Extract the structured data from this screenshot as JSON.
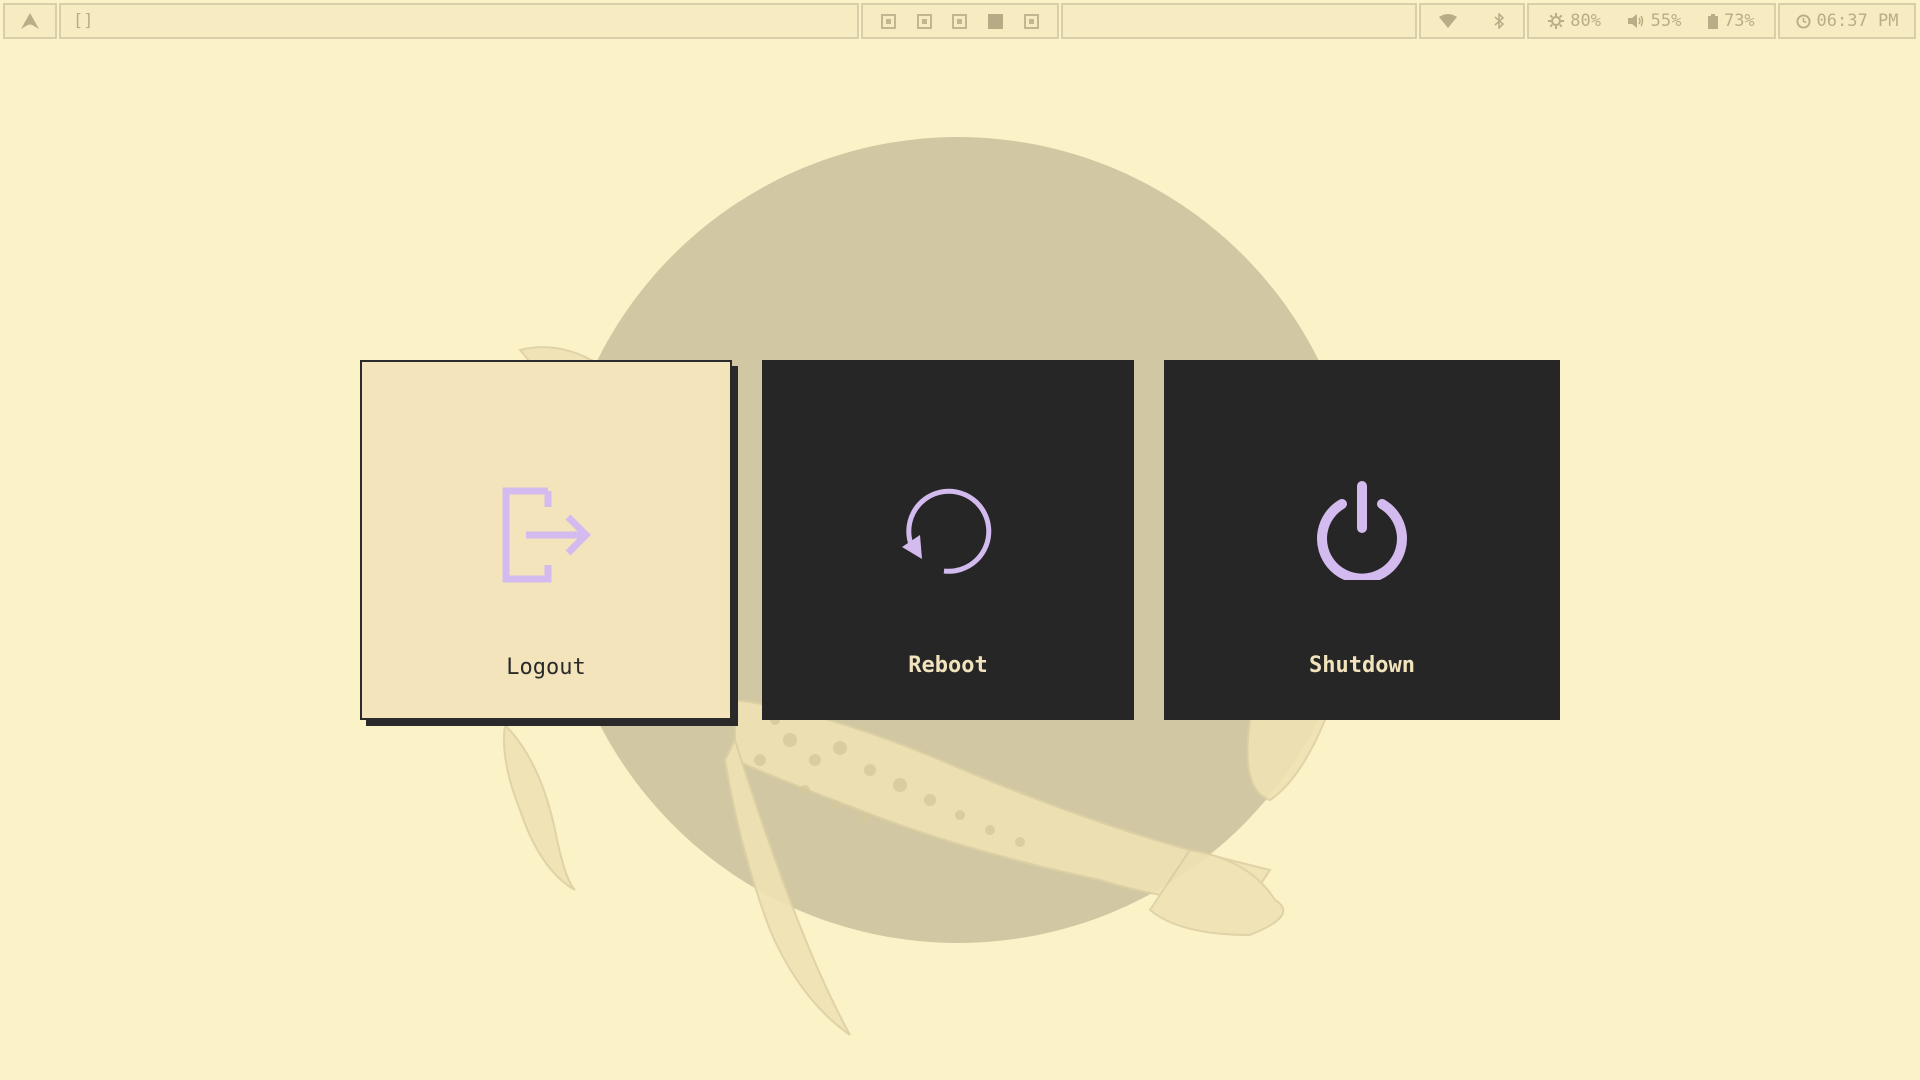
{
  "topbar": {
    "launcher_icon": "arch-logo-icon",
    "layout_text": "[]",
    "workspaces": [
      {
        "name": "workspace-1",
        "active": false
      },
      {
        "name": "workspace-2",
        "active": false
      },
      {
        "name": "workspace-3",
        "active": false
      },
      {
        "name": "workspace-4",
        "active": true
      },
      {
        "name": "workspace-5",
        "active": false
      }
    ],
    "status": {
      "brightness": "80%",
      "volume": "55%",
      "battery": "73%",
      "clock": "06:37 PM"
    }
  },
  "power_menu": {
    "logout": {
      "label": "Logout",
      "icon": "logout-icon"
    },
    "reboot": {
      "label": "Reboot",
      "icon": "reboot-icon"
    },
    "shutdown": {
      "label": "Shutdown",
      "icon": "power-icon"
    }
  },
  "colors": {
    "background": "#fbf2c8",
    "sun": "#d1c7a3",
    "card_dark": "#262626",
    "card_selected": "#f3e4bb",
    "icon_accent": "#d3bbef"
  }
}
